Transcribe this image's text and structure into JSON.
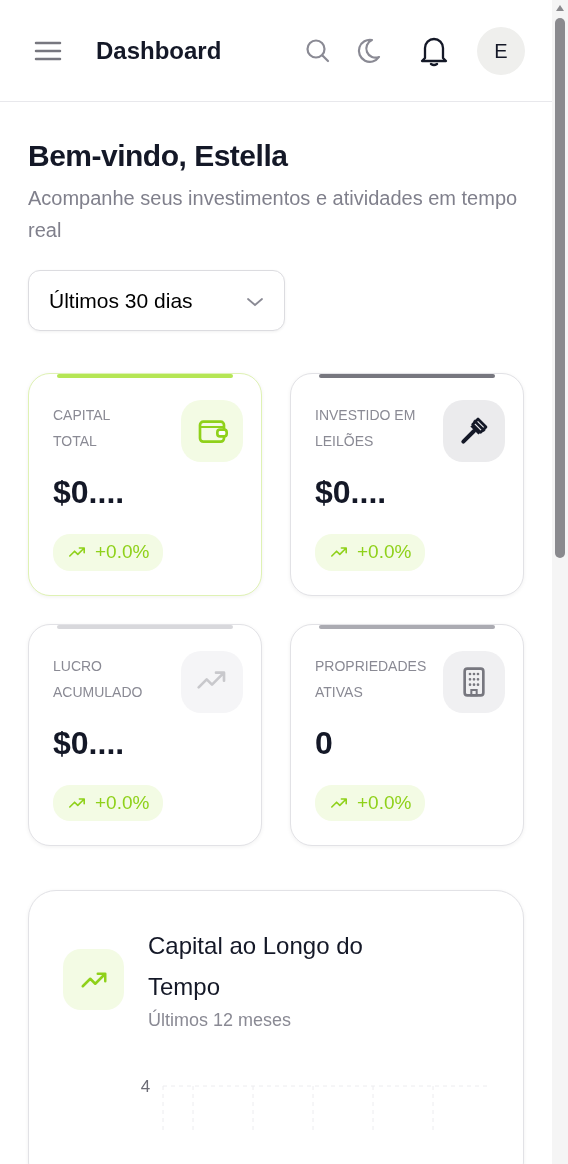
{
  "header": {
    "title": "Dashboard",
    "avatar": "E"
  },
  "welcome": {
    "title": "Bem-vindo, Estella",
    "subtitle": "Acompanhe seus investimentos e atividades em tempo real"
  },
  "period_select": {
    "value": "Últimos 30 dias"
  },
  "stats": [
    {
      "label": "CAPITAL TOTAL",
      "value": "$0....",
      "change": "+0.0%",
      "color": "#b5e655",
      "highlighted": true
    },
    {
      "label": "INVESTIDO EM LEILÕES",
      "value": "$0....",
      "change": "+0.0%",
      "color": "#77777f",
      "highlighted": false
    },
    {
      "label": "LUCRO ACUMULADO",
      "value": "$0....",
      "change": "+0.0%",
      "color": "#d8d8dc",
      "highlighted": false
    },
    {
      "label": "PROPRIEDADES ATIVAS",
      "value": "0",
      "change": "+0.0%",
      "color": "#ababb2",
      "highlighted": false
    }
  ],
  "chart_card": {
    "title": "Capital ao Longo do Tempo",
    "subtitle": "Últimos 12 meses",
    "y_tick_labels": [
      "4"
    ]
  }
}
